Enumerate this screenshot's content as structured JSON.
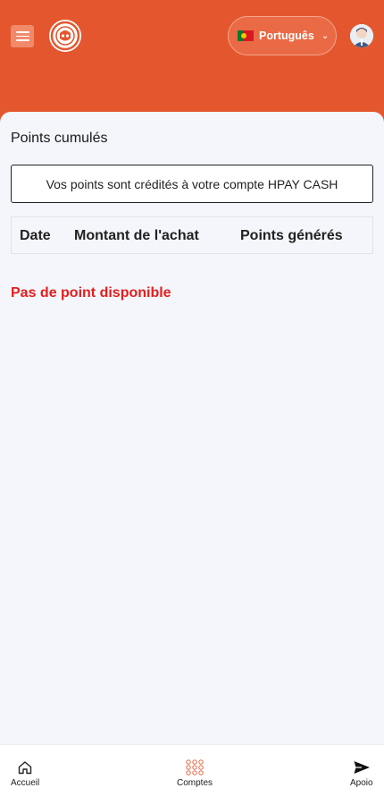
{
  "header": {
    "language_label": "Português",
    "colors": {
      "brand": "#e4572e",
      "lang_pill": "#ea6a45"
    }
  },
  "page": {
    "title": "Points cumulés",
    "notice": "Vos points sont crédités à votre compte HPAY CASH",
    "table": {
      "columns": [
        "Date",
        "Montant de l'achat",
        "Points générés"
      ],
      "rows": []
    },
    "empty_message": "Pas de point disponible",
    "empty_color": "#e31e1e"
  },
  "bottom_nav": {
    "items": [
      {
        "label": "Accueil",
        "icon": "home-icon"
      },
      {
        "label": "Comptes",
        "icon": "grid-dots-icon"
      },
      {
        "label": "Apoio",
        "icon": "send-icon"
      }
    ]
  }
}
